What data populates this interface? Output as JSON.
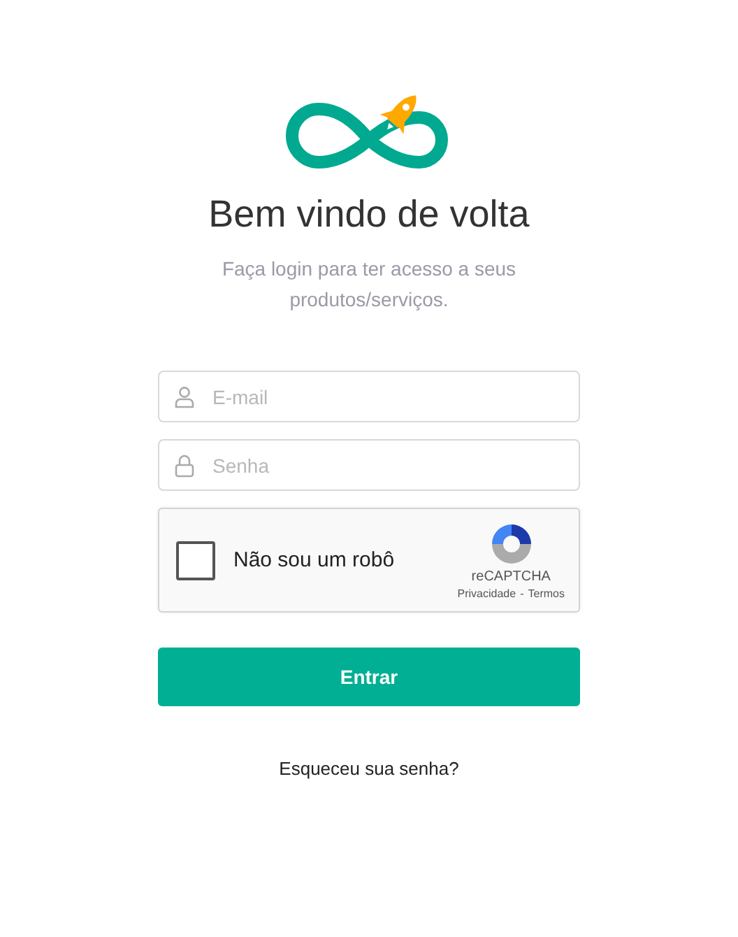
{
  "title": "Bem vindo de volta",
  "subtitle": "Faça login para ter acesso a seus produtos/serviços.",
  "fields": [
    {
      "kind": "user",
      "placeholder": "E-mail"
    },
    {
      "kind": "lock",
      "placeholder": "Senha"
    }
  ],
  "captcha": {
    "checked": false,
    "label": "Não sou um robô",
    "brand": "reCAPTCHA",
    "links": [
      "Privacidade",
      "Termos"
    ],
    "separator": "-"
  },
  "submit": "Entrar",
  "forgot": "Esqueceu sua senha?"
}
